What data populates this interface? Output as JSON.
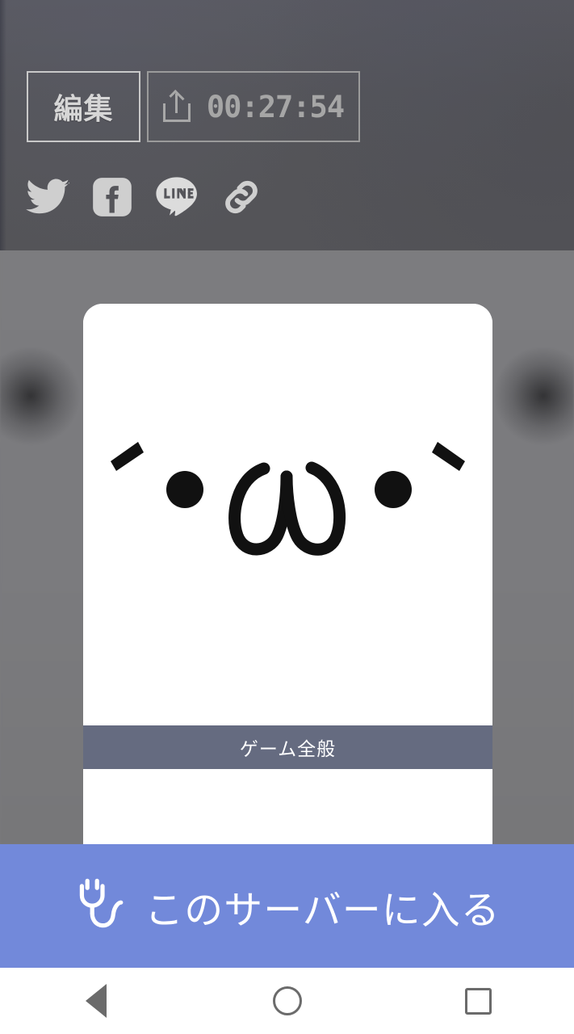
{
  "top_panel": {
    "edit_button_label": "編集",
    "share_icon": "share-upload-icon",
    "timer_value": "00:27:54",
    "social": [
      {
        "name": "twitter",
        "icon": "twitter-bird-icon",
        "label": "Twitter"
      },
      {
        "name": "facebook",
        "icon": "facebook-icon",
        "label": "Facebook"
      },
      {
        "name": "line",
        "icon": "line-icon",
        "label": "LINE"
      },
      {
        "name": "copy-link",
        "icon": "link-chain-icon",
        "label": "Copy link"
      }
    ]
  },
  "main": {
    "card": {
      "type": "kaomoji-avatar",
      "face_text": "´・ω・",
      "background_color": "#ffffff",
      "stroke_color": "#111111"
    },
    "category_label": "ゲーム全般",
    "category_color": "#656b80"
  },
  "cta": {
    "label": "このサーバーに入る",
    "icon": "power-plug-icon",
    "background_color": "#7289da",
    "text_color": "#ffffff"
  },
  "navbar": {
    "back_label": "Back",
    "home_label": "Home",
    "recents_label": "Recents",
    "icons": [
      "triangle-back-icon",
      "circle-home-icon",
      "square-recents-icon"
    ]
  },
  "colors": {
    "top_panel": "#55555a",
    "mid_panel": "#7b7b7e",
    "accent_blue": "#7289da",
    "category": "#656b80",
    "navbar": "#ffffff"
  }
}
